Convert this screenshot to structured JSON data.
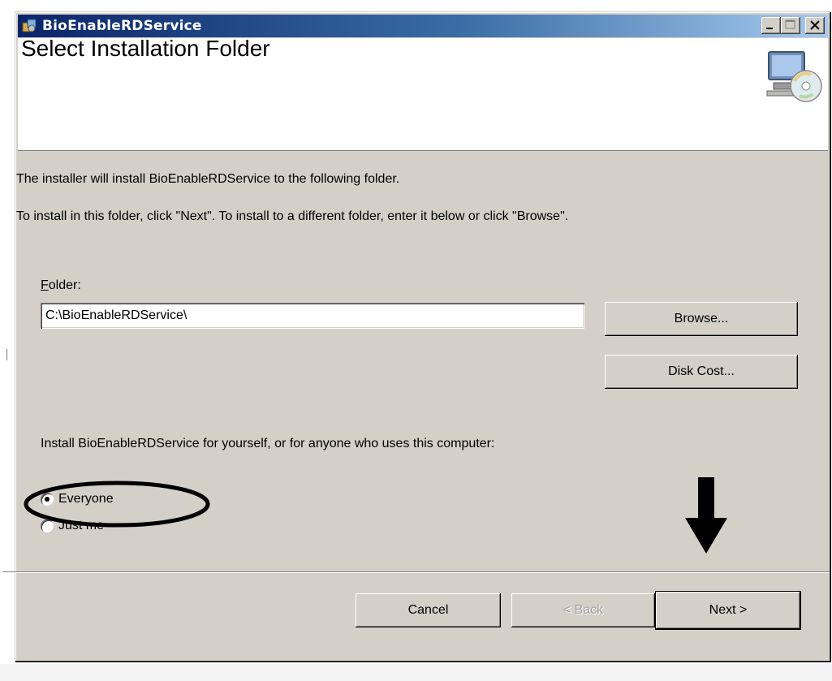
{
  "window": {
    "title": "BioEnableRDService"
  },
  "banner": {
    "title": "Select Installation Folder",
    "icon": "computer-cd-icon"
  },
  "intro": {
    "line1": "The installer will install BioEnableRDService to the following folder.",
    "line2": "To install in this folder, click \"Next\". To install to a different folder, enter it below or click \"Browse\"."
  },
  "folder": {
    "label_accel": "F",
    "label_rest": "older:",
    "value": "C:\\BioEnableRDService\\"
  },
  "buttons": {
    "browse": "Browse...",
    "disk_cost": "Disk Cost...",
    "cancel": "Cancel",
    "back": "< Back",
    "next": "Next >"
  },
  "install_for": {
    "prompt": "Install BioEnableRDService for yourself, or for anyone who uses this computer:",
    "options": [
      {
        "label": "Everyone",
        "checked": true
      },
      {
        "label": "Just me",
        "checked": false
      }
    ]
  },
  "annotations": {
    "highlight": "circle-around-everyone",
    "pointer": "down-arrow-above-next"
  }
}
